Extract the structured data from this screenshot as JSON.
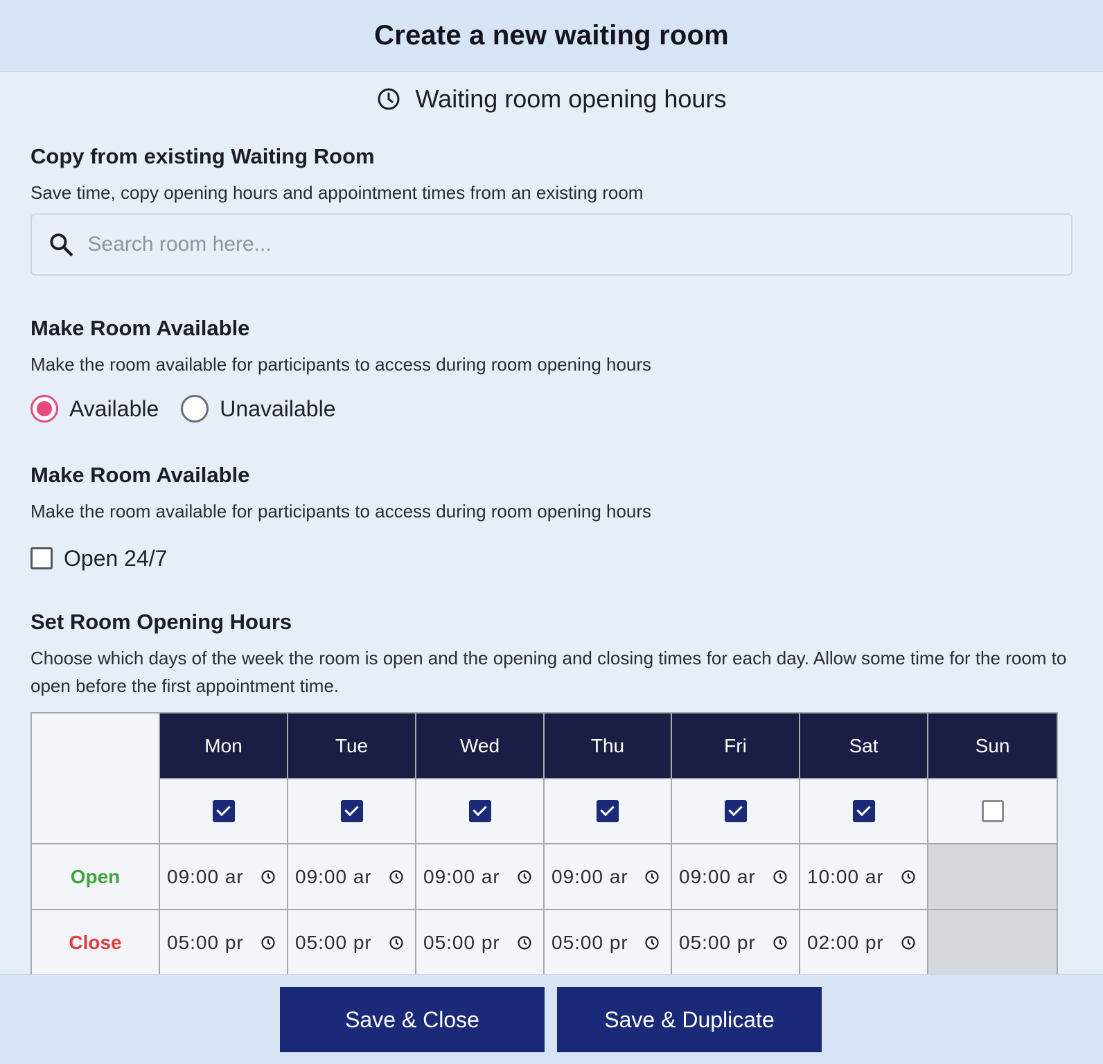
{
  "header": {
    "title": "Create a new waiting room"
  },
  "section": {
    "title": "Waiting room opening hours",
    "icon": "clock-icon"
  },
  "copy": {
    "title": "Copy from existing Waiting Room",
    "description": "Save time, copy opening hours and appointment times from an existing room",
    "search_placeholder": "Search room here..."
  },
  "availability": {
    "title": "Make Room Available",
    "description": "Make the room available for participants to access during room opening hours",
    "options": [
      {
        "label": "Available",
        "selected": true
      },
      {
        "label": "Unavailable",
        "selected": false
      }
    ],
    "accent_color": "#e74a7a"
  },
  "open_always": {
    "title": "Make Room Available",
    "description": "Make the room available for participants to access during room opening hours",
    "checkbox_label": "Open 24/7",
    "checked": false
  },
  "hours": {
    "title": "Set Room Opening Hours",
    "description": "Choose which days of the week the room is open and the opening and closing times for each day. Allow some time for the room to open before the first appointment time.",
    "open_label": "Open",
    "close_label": "Close",
    "open_color": "#3fa53f",
    "close_color": "#e03c3c",
    "days": [
      {
        "name": "Mon",
        "enabled": true,
        "open": "09:00 ar",
        "close": "05:00 pr"
      },
      {
        "name": "Tue",
        "enabled": true,
        "open": "09:00 ar",
        "close": "05:00 pr"
      },
      {
        "name": "Wed",
        "enabled": true,
        "open": "09:00 ar",
        "close": "05:00 pr"
      },
      {
        "name": "Thu",
        "enabled": true,
        "open": "09:00 ar",
        "close": "05:00 pr"
      },
      {
        "name": "Fri",
        "enabled": true,
        "open": "09:00 ar",
        "close": "05:00 pr"
      },
      {
        "name": "Sat",
        "enabled": true,
        "open": "10:00 ar",
        "close": "02:00 pr"
      },
      {
        "name": "Sun",
        "enabled": false,
        "open": "",
        "close": ""
      }
    ]
  },
  "footer": {
    "save_close_label": "Save & Close",
    "save_duplicate_label": "Save & Duplicate",
    "button_color": "#1b2a78"
  }
}
